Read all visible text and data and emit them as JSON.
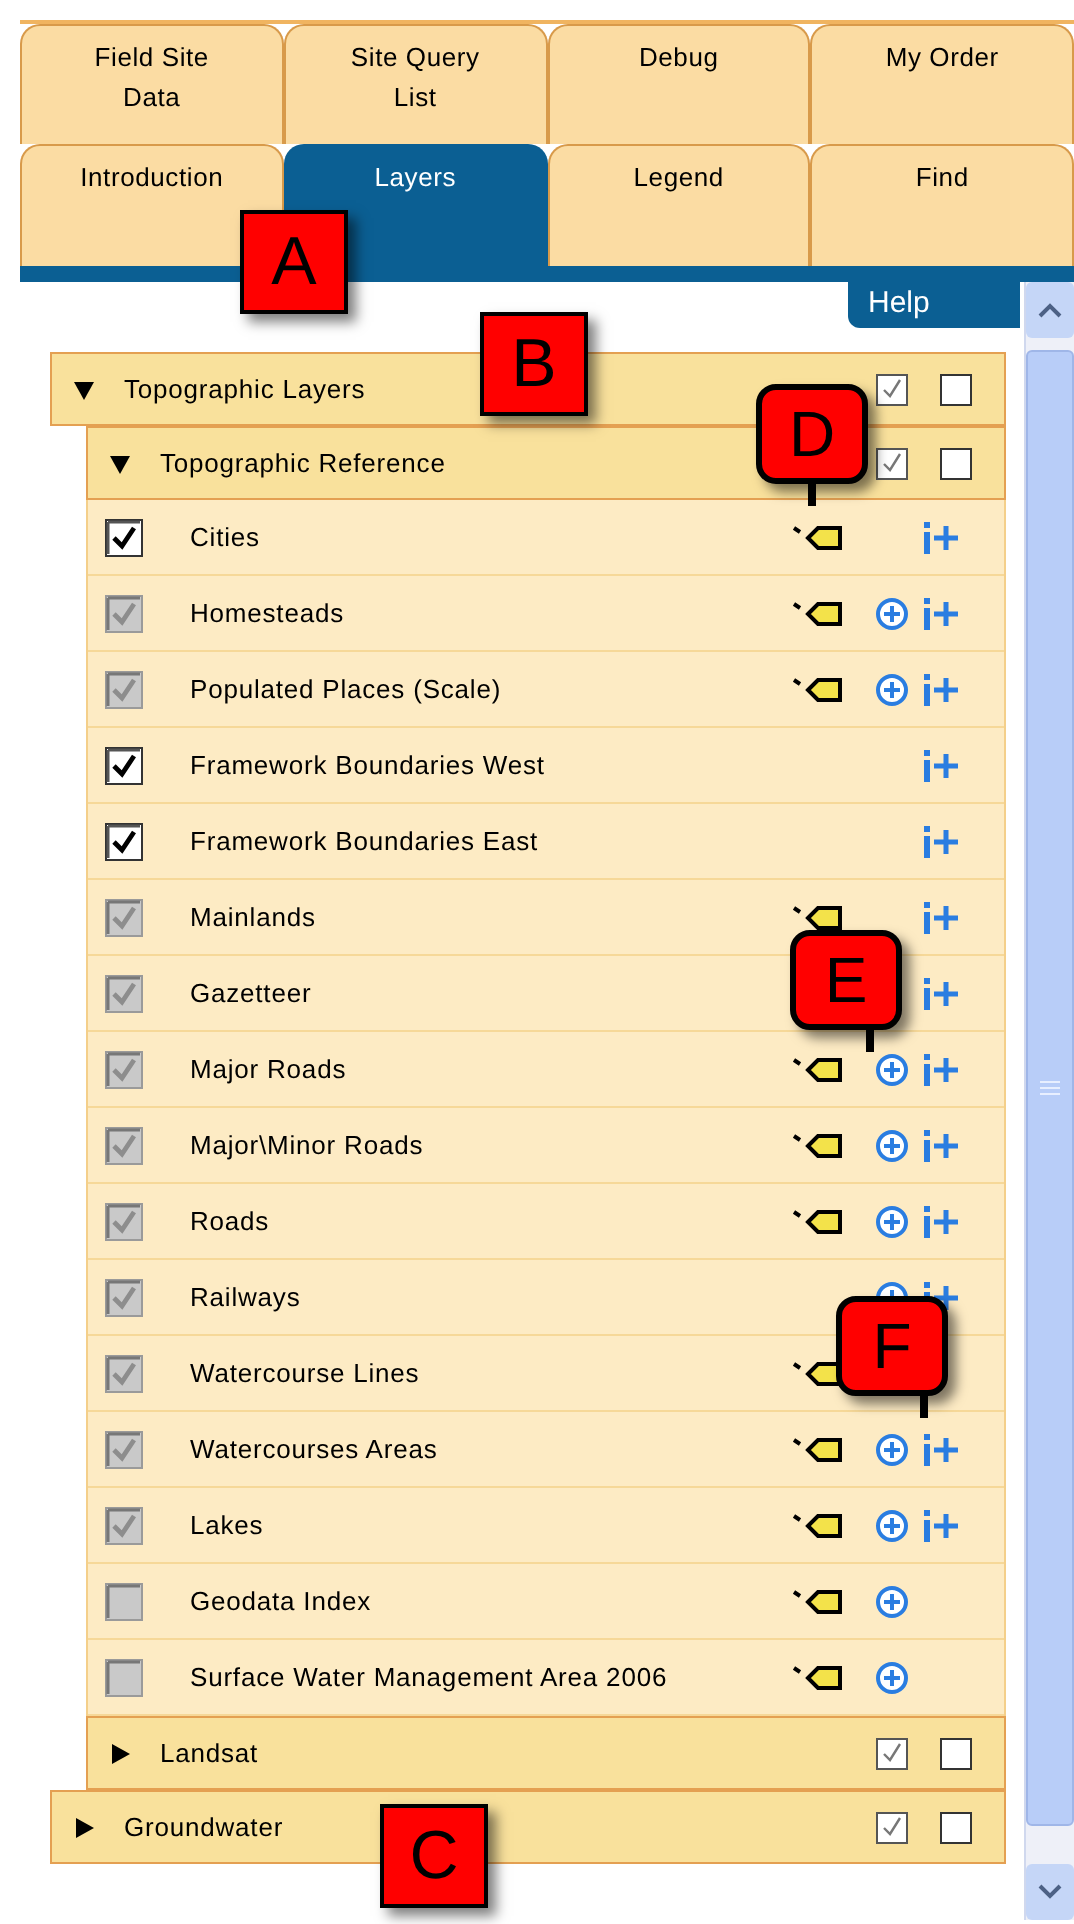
{
  "tabs_top": [
    {
      "label": "Field Site Data",
      "selected": false
    },
    {
      "label": "Site Query List",
      "selected": false
    },
    {
      "label": "Debug",
      "selected": false
    },
    {
      "label": "My Order",
      "selected": false
    }
  ],
  "tabs_bottom": [
    {
      "label": "Introduction",
      "selected": false
    },
    {
      "label": "Layers",
      "selected": true
    },
    {
      "label": "Legend",
      "selected": false
    },
    {
      "label": "Find",
      "selected": false
    }
  ],
  "help_tab": "Help",
  "groups": [
    {
      "title": "Topographic Layers",
      "expanded": true,
      "boxes": [
        {
          "checked": true
        },
        {
          "checked": false
        }
      ],
      "children": [
        {
          "title": "Topographic Reference",
          "expanded": true,
          "boxes": [
            {
              "checked": true
            },
            {
              "checked": false
            }
          ],
          "layers": [
            {
              "name": "Cities",
              "checked": true,
              "disabled": false,
              "tag": true,
              "zoom": false,
              "info": true
            },
            {
              "name": "Homesteads",
              "checked": true,
              "disabled": true,
              "tag": true,
              "zoom": true,
              "info": true
            },
            {
              "name": "Populated Places (Scale)",
              "checked": true,
              "disabled": true,
              "tag": true,
              "zoom": true,
              "info": true
            },
            {
              "name": "Framework Boundaries West",
              "checked": true,
              "disabled": false,
              "tag": false,
              "zoom": false,
              "info": true
            },
            {
              "name": "Framework Boundaries East",
              "checked": true,
              "disabled": false,
              "tag": false,
              "zoom": false,
              "info": true
            },
            {
              "name": "Mainlands",
              "checked": true,
              "disabled": true,
              "tag": true,
              "zoom": false,
              "info": true
            },
            {
              "name": "Gazetteer",
              "checked": true,
              "disabled": true,
              "tag": false,
              "zoom": false,
              "info": true
            },
            {
              "name": "Major Roads",
              "checked": true,
              "disabled": true,
              "tag": true,
              "zoom": true,
              "info": true
            },
            {
              "name": "Major\\Minor Roads",
              "checked": true,
              "disabled": true,
              "tag": true,
              "zoom": true,
              "info": true
            },
            {
              "name": "Roads",
              "checked": true,
              "disabled": true,
              "tag": true,
              "zoom": true,
              "info": true
            },
            {
              "name": "Railways",
              "checked": true,
              "disabled": true,
              "tag": false,
              "zoom": true,
              "info": true
            },
            {
              "name": "Watercourse Lines",
              "checked": true,
              "disabled": true,
              "tag": true,
              "zoom": false,
              "info": false
            },
            {
              "name": "Watercourses Areas",
              "checked": true,
              "disabled": true,
              "tag": true,
              "zoom": true,
              "info": true
            },
            {
              "name": "Lakes",
              "checked": true,
              "disabled": true,
              "tag": true,
              "zoom": true,
              "info": true
            },
            {
              "name": "Geodata Index",
              "checked": false,
              "disabled": true,
              "tag": true,
              "zoom": true,
              "info": false
            },
            {
              "name": "Surface Water Management Area 2006",
              "checked": false,
              "disabled": true,
              "tag": true,
              "zoom": true,
              "info": false
            }
          ]
        },
        {
          "title": "Landsat",
          "expanded": false,
          "boxes": [
            {
              "checked": true
            },
            {
              "checked": false
            }
          ]
        }
      ]
    },
    {
      "title": "Groundwater",
      "expanded": false,
      "boxes": [
        {
          "checked": true
        },
        {
          "checked": false
        }
      ]
    }
  ],
  "callouts": [
    {
      "label": "A",
      "kind": "square"
    },
    {
      "label": "B",
      "kind": "square"
    },
    {
      "label": "C",
      "kind": "square"
    },
    {
      "label": "D",
      "kind": "bubble"
    },
    {
      "label": "E",
      "kind": "bubble"
    },
    {
      "label": "F",
      "kind": "bubble"
    }
  ]
}
